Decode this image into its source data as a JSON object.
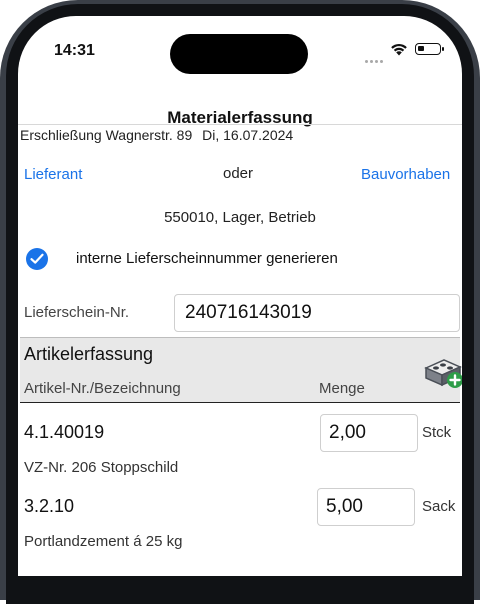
{
  "status": {
    "time": "14:31"
  },
  "header": {
    "title": "Materialerfassung"
  },
  "info": {
    "site": "Erschließung Wagnerstr. 89",
    "date": "Di, 16.07.2024"
  },
  "links": {
    "supplier": "Lieferant",
    "or": "oder",
    "project": "Bauvorhaben"
  },
  "address": "550010, Lager, Betrieb",
  "generate": {
    "checked": true,
    "label": "interne Lieferscheinnummer generieren"
  },
  "delivery_note": {
    "label": "Lieferschein-Nr.",
    "value": "240716143019"
  },
  "articles": {
    "title": "Artikelerfassung",
    "col_article": "Artikel-Nr./Bezeichnung",
    "col_qty": "Menge",
    "rows": [
      {
        "number": "4.1.40019",
        "qty": "2,00",
        "unit": "Stck",
        "desc": "VZ-Nr. 206 Stoppschild"
      },
      {
        "number": "3.2.10",
        "qty": "5,00",
        "unit": "Sack",
        "desc": "Portlandzement á 25 kg"
      }
    ]
  },
  "colors": {
    "accent": "#1a73e8",
    "add": "#2e9d48",
    "frame": "#3a3f47"
  }
}
